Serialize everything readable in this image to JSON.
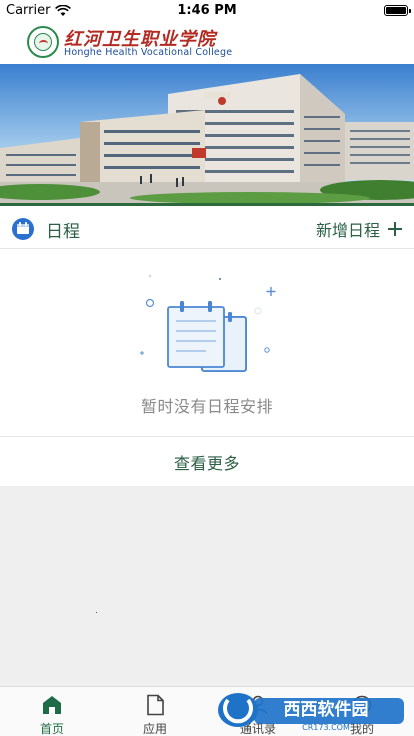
{
  "status_bar": {
    "carrier": "Carrier",
    "time": "1:46 PM"
  },
  "header": {
    "logo_cn": "红河卫生职业学院",
    "logo_en": "Honghe Health Vocational College"
  },
  "schedule": {
    "title": "日程",
    "add_label": "新增日程",
    "empty_text": "暂时没有日程安排",
    "view_more": "查看更多"
  },
  "tabs": [
    {
      "label": "首页",
      "icon": "home-icon",
      "active": true
    },
    {
      "label": "应用",
      "icon": "document-icon",
      "active": false
    },
    {
      "label": "通讯录",
      "icon": "contacts-icon",
      "active": false
    },
    {
      "label": "我的",
      "icon": "profile-icon",
      "active": false
    }
  ],
  "watermark": {
    "text": "西西软件园",
    "sub": "CR173.COM"
  },
  "colors": {
    "accent": "#2b5f46",
    "tab_active": "#1f6b47",
    "calendar_blue": "#2b6fcf",
    "brand_red": "#b22a22"
  }
}
